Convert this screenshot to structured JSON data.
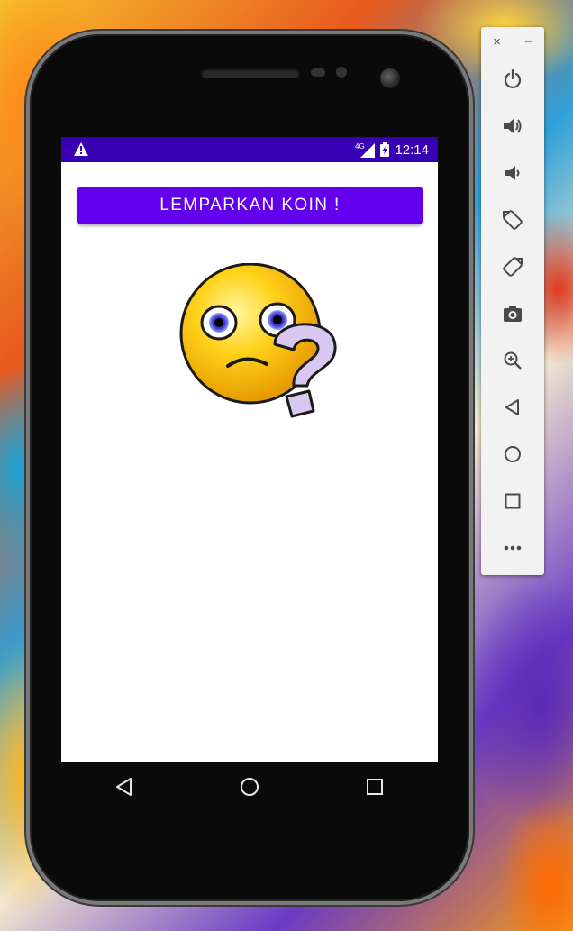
{
  "device": {
    "status_bar": {
      "warning_icon": "warning-triangle-icon",
      "network": "4G",
      "battery_icon": "battery-charging-icon",
      "time": "12:14"
    },
    "app": {
      "flip_button_label": "LEMPARKAN KOIN !",
      "image_icon": "confused-face-question-icon"
    },
    "nav_bar": [
      "back-icon",
      "home-icon",
      "recents-icon"
    ]
  },
  "emulator_toolbar": {
    "close_label": "×",
    "minimize_label": "−",
    "items": [
      "power-icon",
      "volume-up-icon",
      "volume-down-icon",
      "rotate-left-icon",
      "rotate-right-icon",
      "camera-icon",
      "zoom-icon",
      "back-icon",
      "home-icon",
      "overview-icon",
      "more-icon"
    ]
  },
  "colors": {
    "status_bar": "#3700b3",
    "button": "#6200ee",
    "screen_bg": "#ffffff"
  }
}
